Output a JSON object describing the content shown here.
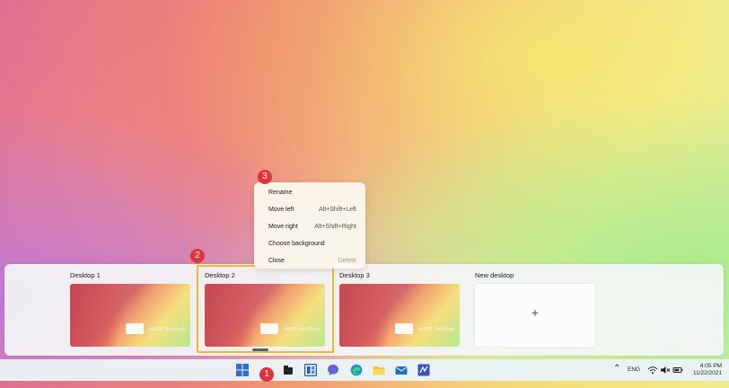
{
  "desktops": [
    {
      "name": "Desktop 1",
      "brand": "ASUS VivoBook"
    },
    {
      "name": "Desktop 2",
      "brand": "ASUS VivoBook"
    },
    {
      "name": "Desktop 3",
      "brand": "ASUS VivoBook"
    }
  ],
  "new_desktop": {
    "label": "New desktop",
    "icon": "+"
  },
  "context_menu": {
    "items": [
      {
        "label": "Rename",
        "shortcut": ""
      },
      {
        "label": "Move left",
        "shortcut": "Alt+Shift+Left"
      },
      {
        "label": "Move right",
        "shortcut": "Alt+Shift+Right"
      },
      {
        "label": "Choose background",
        "shortcut": ""
      },
      {
        "label": "Close",
        "shortcut": "Delete"
      }
    ]
  },
  "badges": [
    "1",
    "2",
    "3"
  ],
  "taskbar": {
    "icons": [
      "windows-start-icon",
      "task-view-icon",
      "widgets-icon",
      "teams-chat-icon",
      "edge-icon",
      "file-explorer-icon",
      "mail-icon",
      "visual-studio-icon"
    ],
    "tray": {
      "language": "ENG",
      "time": "4:05 PM",
      "date": "11/22/2021"
    }
  },
  "colors": {
    "highlight": "#f0b82a",
    "badge": "#e0343c",
    "accent": "#2f6fd0"
  }
}
